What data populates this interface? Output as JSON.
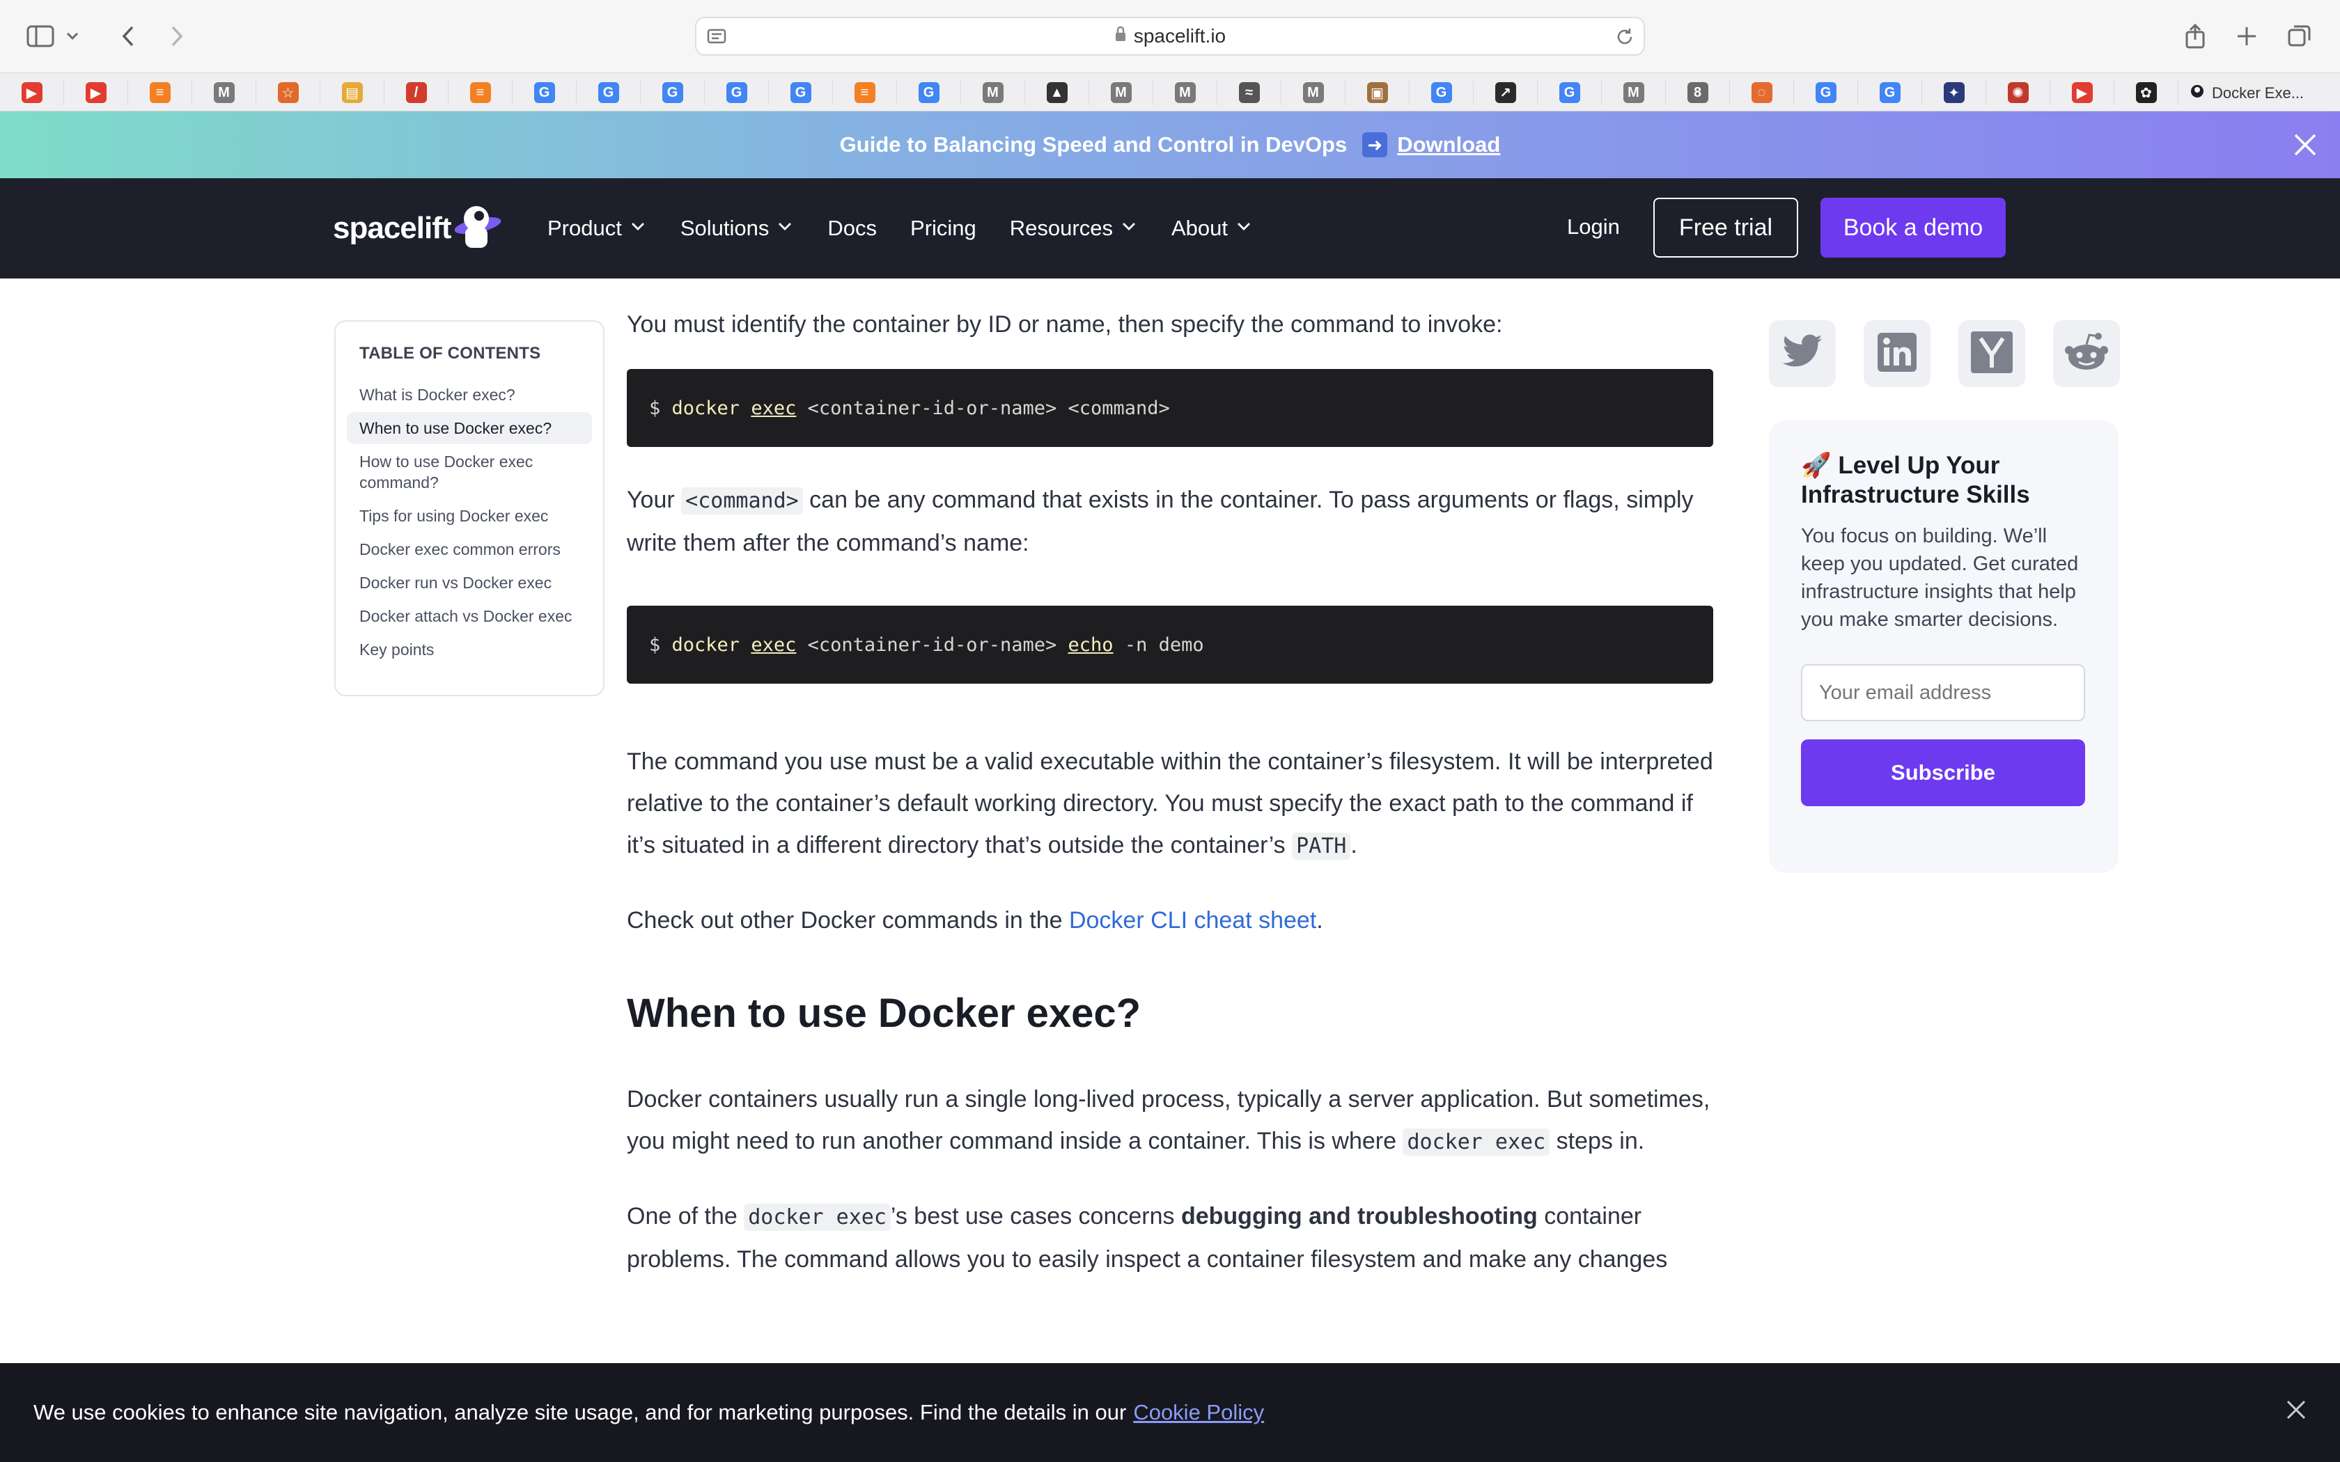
{
  "browser": {
    "url": "spacelift.io",
    "active_tab": "Docker Exe..."
  },
  "bookmarks": [
    {
      "icon": "youtube-icon",
      "color": "#e03c31",
      "glyph": "▶"
    },
    {
      "icon": "youtube-icon",
      "color": "#e03c31",
      "glyph": "▶"
    },
    {
      "icon": "stackoverflow-icon",
      "color": "#f48024",
      "glyph": "≡"
    },
    {
      "icon": "medium-icon",
      "color": "#7a7a7a",
      "glyph": "M"
    },
    {
      "icon": "star-icon",
      "color": "#e06a2b",
      "glyph": "☆"
    },
    {
      "icon": "folder-icon",
      "color": "#e6a93a",
      "glyph": "▤"
    },
    {
      "icon": "pen-icon",
      "color": "#d23c2c",
      "glyph": "/"
    },
    {
      "icon": "stackoverflow-icon",
      "color": "#f48024",
      "glyph": "≡"
    },
    {
      "icon": "google-icon",
      "color": "#4285f4",
      "glyph": "G"
    },
    {
      "icon": "google-icon",
      "color": "#4285f4",
      "glyph": "G"
    },
    {
      "icon": "google-icon",
      "color": "#4285f4",
      "glyph": "G"
    },
    {
      "icon": "google-icon",
      "color": "#4285f4",
      "glyph": "G"
    },
    {
      "icon": "google-icon",
      "color": "#4285f4",
      "glyph": "G"
    },
    {
      "icon": "stackoverflow-icon",
      "color": "#f48024",
      "glyph": "≡"
    },
    {
      "icon": "google-icon",
      "color": "#4285f4",
      "glyph": "G"
    },
    {
      "icon": "medium-icon",
      "color": "#7a7a7a",
      "glyph": "M"
    },
    {
      "icon": "graduation-cap-icon",
      "color": "#333333",
      "glyph": "▲"
    },
    {
      "icon": "medium-icon",
      "color": "#7a7a7a",
      "glyph": "M"
    },
    {
      "icon": "medium-icon",
      "color": "#7a7a7a",
      "glyph": "M"
    },
    {
      "icon": "text-logo-icon",
      "color": "#555555",
      "glyph": "≈"
    },
    {
      "icon": "medium-icon",
      "color": "#7a7a7a",
      "glyph": "M"
    },
    {
      "icon": "photo-icon",
      "color": "#a07040",
      "glyph": "▣"
    },
    {
      "icon": "google-icon",
      "color": "#4285f4",
      "glyph": "G"
    },
    {
      "icon": "chart-line-icon",
      "color": "#2b2b2b",
      "glyph": "↗"
    },
    {
      "icon": "google-icon",
      "color": "#4285f4",
      "glyph": "G"
    },
    {
      "icon": "medium-icon",
      "color": "#7a7a7a",
      "glyph": "M"
    },
    {
      "icon": "number-icon",
      "color": "#6a6a6a",
      "glyph": "8"
    },
    {
      "icon": "spinner-icon",
      "color": "#e36b2f",
      "glyph": "◌"
    },
    {
      "icon": "google-icon",
      "color": "#4285f4",
      "glyph": "G"
    },
    {
      "icon": "google-icon",
      "color": "#4285f4",
      "glyph": "G"
    },
    {
      "icon": "astronaut-icon",
      "color": "#2a3a7a",
      "glyph": "✦"
    },
    {
      "icon": "spot-logo-icon",
      "color": "#c0392b",
      "glyph": "✺"
    },
    {
      "icon": "youtube-icon",
      "color": "#e03c31",
      "glyph": "▶"
    },
    {
      "icon": "openai-icon",
      "color": "#222222",
      "glyph": "✿"
    }
  ],
  "promo": {
    "text": "Guide to Balancing Speed and Control in DevOps",
    "link": "Download"
  },
  "nav": {
    "logo": "spacelift",
    "items": [
      {
        "label": "Product",
        "dropdown": true
      },
      {
        "label": "Solutions",
        "dropdown": true
      },
      {
        "label": "Docs",
        "dropdown": false
      },
      {
        "label": "Pricing",
        "dropdown": false
      },
      {
        "label": "Resources",
        "dropdown": true
      },
      {
        "label": "About",
        "dropdown": true
      }
    ],
    "login": "Login",
    "free_trial": "Free trial",
    "book_demo": "Book a demo"
  },
  "toc": {
    "title": "TABLE OF CONTENTS",
    "items": [
      "What is Docker exec?",
      "When to use Docker exec?",
      "How to use Docker exec command?",
      "Tips for using Docker exec",
      "Docker exec common errors",
      "Docker run vs Docker exec",
      "Docker attach vs Docker exec",
      "Key points"
    ],
    "active_index": 1
  },
  "article": {
    "p1": "You must identify the container by ID or name, then specify the command to invoke:",
    "code1": {
      "prompt": "$",
      "cmd": "docker",
      "sub": "exec",
      "args": "<container-id-or-name> <command>"
    },
    "p2_a": "Your",
    "p2_code": "<command>",
    "p2_b": "can be any command that exists in the container. To pass arguments or flags, simply write them after the command’s name:",
    "code2": {
      "prompt": "$",
      "cmd": "docker",
      "sub": "exec",
      "args": "<container-id-or-name>",
      "echo": "echo",
      "rest": "-n demo"
    },
    "p3_a": "The command you use must be a valid executable within the container’s filesystem. It will be interpreted relative to the container’s default working directory. You must specify the exact path to the command if it’s situated in a different directory that’s outside the container’s",
    "p3_code": "PATH",
    "p3_b": ".",
    "p4_a": "Check out other Docker commands in the",
    "p4_link": "Docker CLI cheat sheet",
    "p4_b": ".",
    "h2": "When to use Docker exec?",
    "p5_a": "Docker containers usually run a single long-lived process, typically a server application. But sometimes, you might need to run another command inside a container. This is where",
    "p5_code": "docker exec",
    "p5_b": "steps in.",
    "p6_a": "One of the",
    "p6_code": "docker exec",
    "p6_b": "’s best use cases concerns",
    "p6_bold": "debugging and troubleshooting",
    "p6_c": "container problems. The command allows you to easily inspect a container filesystem and make any changes"
  },
  "newsletter": {
    "emoji": "🚀",
    "title": "Level Up Your Infrastructure Skills",
    "desc": "You focus on building. We’ll keep you updated. Get curated infrastructure insights that help you make smarter decisions.",
    "placeholder": "Your email address",
    "button": "Subscribe"
  },
  "share": [
    "twitter-icon",
    "linkedin-icon",
    "hacker-news-icon",
    "reddit-icon"
  ],
  "cookie": {
    "text": "We use cookies to enhance site navigation, analyze site usage, and for marketing purposes. Find the details in our",
    "link": "Cookie Policy"
  },
  "colors": {
    "accent": "#6d3af0",
    "nav_bg": "#1d1f2a",
    "code_bg": "#1e1e21",
    "link": "#2f6ad9"
  }
}
